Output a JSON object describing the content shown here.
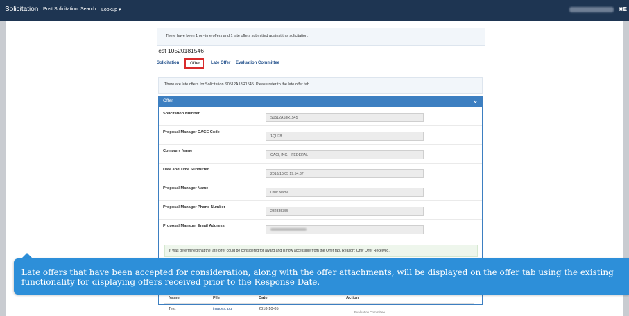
{
  "navbar": {
    "brand": "Solicitation",
    "items": [
      "Post Solicitation",
      "Search",
      "Lookup ▾"
    ],
    "close_label": "✖E"
  },
  "alert_top": "There have been 1 on-time offers and 1 late offers submitted against this solicitation.",
  "page_title": "Test 10520181546",
  "tabs": [
    {
      "label": "Solicitation",
      "active": false
    },
    {
      "label": "Offer",
      "active": true
    },
    {
      "label": "Late Offer",
      "active": false
    },
    {
      "label": "Evaluation Committee",
      "active": false
    }
  ],
  "alert_late": "There are late offers for Solicitation S0512A18R1545. Please refer to the late offer tab.",
  "panel": {
    "title": "Offer",
    "fields": [
      {
        "label": "Solicitation Number",
        "value": "S0512A18R1545"
      },
      {
        "label": "Proposal Manager CAGE Code",
        "value": "1QU78"
      },
      {
        "label": "Company Name",
        "value": "CACI, INC. - FEDERAL"
      },
      {
        "label": "Date and Time Submitted",
        "value": "2018/10/05 19:54:37"
      },
      {
        "label": "Proposal Manager Name",
        "value": "User Name"
      },
      {
        "label": "Proposal Manager Phone Number",
        "value": "232335355"
      },
      {
        "label": "Proposal Manager Email Address",
        "value": ""
      }
    ],
    "alert_ok": "It was determined that the late offer could be considered for award and is now accessible from the Offer tab. Reason: Only Offer Received.",
    "table": {
      "headers": [
        "Name",
        "File",
        "Date",
        "Action"
      ],
      "rows": [
        {
          "name": "Test",
          "file": "images.jpg",
          "date": "2018-10-05",
          "action": "Evaluation Committee"
        }
      ]
    }
  },
  "callout": "Late offers that have been accepted for consideration, along with the offer attachments, will be displayed on the offer tab using the existing functionality for displaying offers received prior to the Response Date.",
  "colors": {
    "navbar": "#1e3552",
    "panel_header": "#3d7fc1",
    "tab_highlight": "#d92b2b",
    "callout": "#2d8fd9"
  }
}
